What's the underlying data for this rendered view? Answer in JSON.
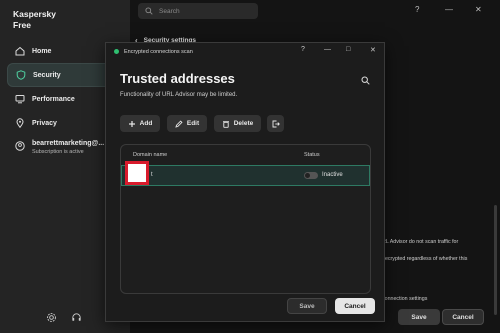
{
  "sidebar": {
    "app_title_line1": "Kaspersky",
    "app_title_line2": "Free",
    "items": [
      {
        "label": "Home",
        "icon": "home-icon"
      },
      {
        "label": "Security",
        "icon": "shield-icon"
      },
      {
        "label": "Performance",
        "icon": "monitor-icon"
      },
      {
        "label": "Privacy",
        "icon": "location-icon"
      }
    ],
    "account_name": "bearrettmarketing@...",
    "account_status": "Subscription is active",
    "bottom_icons": [
      "gear-icon",
      "headset-icon"
    ]
  },
  "main": {
    "search_placeholder": "Search",
    "help_label": "?",
    "back_title": "Security settings",
    "bg_text_1": "RL Advisor do not scan traffic for",
    "bg_text_2": "decrypted regardless of whether this",
    "bg_text_3": "connection settings",
    "save_label": "Save",
    "cancel_label": "Cancel"
  },
  "dialog": {
    "window_title": "Encrypted connections scan",
    "help_label": "?",
    "heading": "Trusted addresses",
    "subtitle": "Functionality of URL Advisor may be limited.",
    "toolbar": {
      "add_label": "Add",
      "edit_label": "Edit",
      "delete_label": "Delete"
    },
    "table": {
      "col_domain": "Domain name",
      "col_status": "Status",
      "rows": [
        {
          "domain": "t",
          "status": "Inactive"
        }
      ]
    },
    "save_label": "Save",
    "cancel_label": "Cancel"
  },
  "colors": {
    "accent_green": "#2fbf71",
    "selected_row": "#20312f",
    "redaction_border": "#d81b2c"
  }
}
